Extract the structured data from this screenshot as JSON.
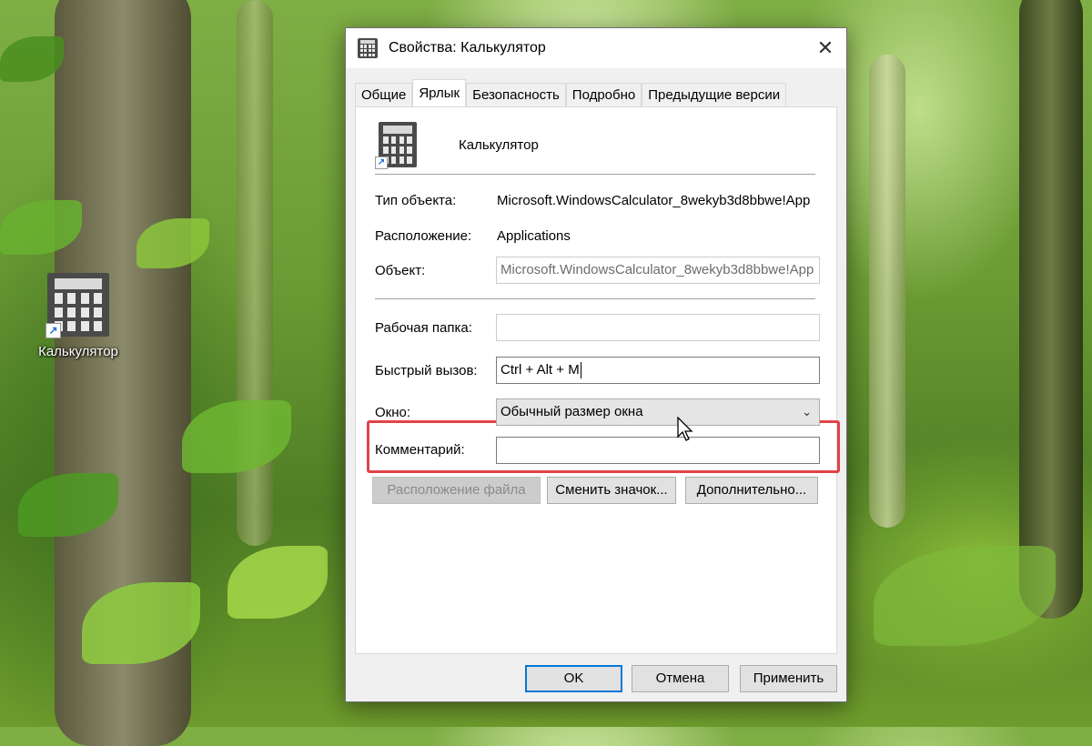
{
  "desktop": {
    "icon_label": "Калькулятор"
  },
  "window": {
    "title": "Свойства: Калькулятор",
    "tabs": [
      {
        "label": "Общие"
      },
      {
        "label": "Ярлык",
        "active": true
      },
      {
        "label": "Безопасность"
      },
      {
        "label": "Подробно"
      },
      {
        "label": "Предыдущие версии"
      }
    ],
    "header_name": "Калькулятор",
    "fields": {
      "type_label": "Тип объекта:",
      "type_value": "Microsoft.WindowsCalculator_8wekyb3d8bbwe!App",
      "location_label": "Расположение:",
      "location_value": "Applications",
      "target_label": "Объект:",
      "target_value": "Microsoft.WindowsCalculator_8wekyb3d8bbwe!App",
      "workdir_label": "Рабочая папка:",
      "workdir_value": "",
      "hotkey_label": "Быстрый вызов:",
      "hotkey_value": "Ctrl + Alt + M",
      "window_label": "Окно:",
      "window_value": "Обычный размер окна",
      "comment_label": "Комментарий:",
      "comment_value": ""
    },
    "buttons": {
      "open_location": "Расположение файла",
      "change_icon": "Сменить значок...",
      "advanced": "Дополнительно...",
      "ok": "OK",
      "cancel": "Отмена",
      "apply": "Применить"
    },
    "colors": {
      "highlight": "#e04446",
      "accent": "#0078d7"
    }
  }
}
